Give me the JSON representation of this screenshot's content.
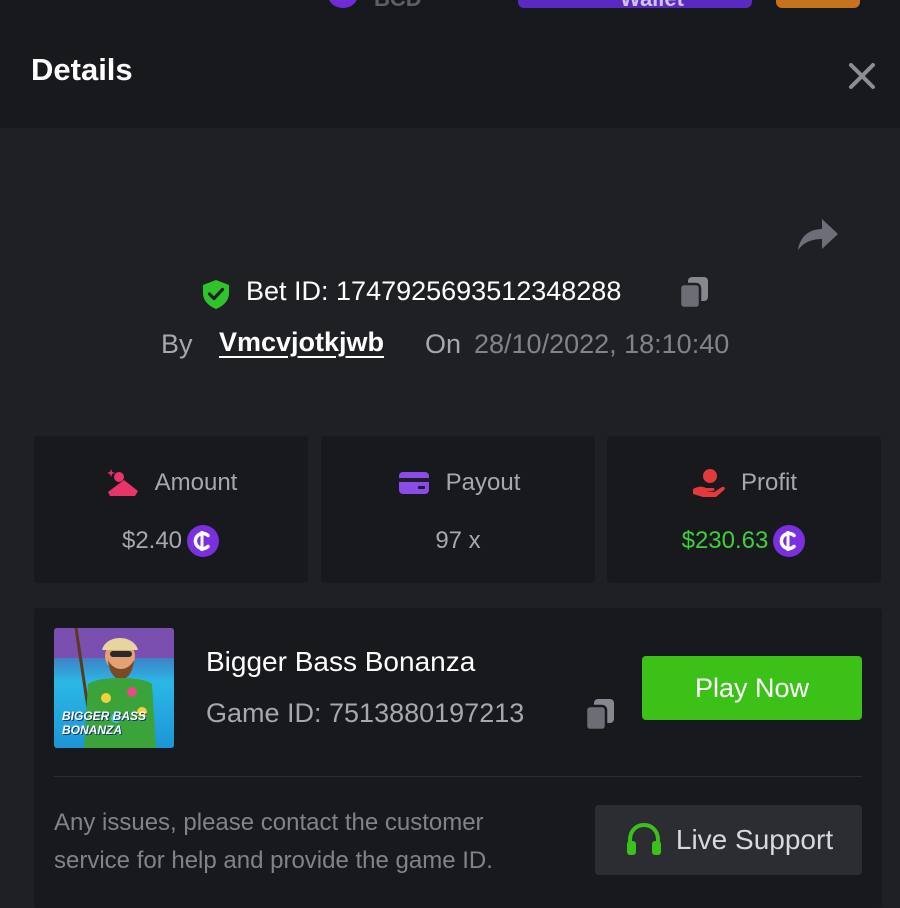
{
  "top_bar": {
    "currency": "BCD",
    "wallet_label": "Wallet"
  },
  "header": {
    "title": "Details"
  },
  "bet": {
    "id_label": "Bet ID: 1747925693512348288",
    "by_label": "By",
    "username": "Vmcvjotkjwb",
    "on_label": "On",
    "datetime": "28/10/2022, 18:10:40"
  },
  "stats": {
    "amount": {
      "label": "Amount",
      "value": "$2.40"
    },
    "payout": {
      "label": "Payout",
      "value": "97 x"
    },
    "profit": {
      "label": "Profit",
      "value": "$230.63"
    }
  },
  "game": {
    "title": "Bigger Bass Bonanza",
    "id_label": "Game ID: 7513880197213",
    "thumb_text_line1": "BIGGER BASS",
    "thumb_text_line2": "BONANZA",
    "play_label": "Play Now"
  },
  "support": {
    "help_text": "Any issues, please contact the customer service for help and provide the game ID.",
    "button_label": "Live Support"
  },
  "colors": {
    "background": "#1f2024",
    "card": "#18191c",
    "accent_green": "#3bc117",
    "profit_green": "#3fcf3a",
    "coin_purple": "#7a2fe0",
    "amount_pink": "#e8336b",
    "payout_purple": "#8b4be8",
    "profit_red": "#e23a3a"
  }
}
